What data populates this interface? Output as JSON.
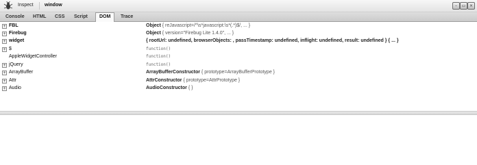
{
  "toolbar": {
    "inspect_label": "Inspect",
    "title": "window"
  },
  "tabs": [
    "Console",
    "HTML",
    "CSS",
    "Script",
    "DOM",
    "Trace"
  ],
  "active_tab": "DOM",
  "window_controls": {
    "minimize_glyph": "–",
    "restore_glyph": "▭",
    "close_glyph": "×"
  },
  "dom_rows": [
    {
      "name": "FBL",
      "value": "Object",
      "detail": "{ reJavascript=/^\\s*javascript:\\s*(.*)$/, ... }"
    },
    {
      "name": "Firebug",
      "value": "Object",
      "detail": "{ version=\"Firebug Lite 1.4.0\", ... }"
    },
    {
      "name": "widget",
      "value": "{ rootUrl: undefined, browserObjects: , passTimestamp: undefined, inflight: undefined, result: undefined } { ... }",
      "detail": ""
    },
    {
      "name": "$",
      "value": "function()",
      "detail": ""
    },
    {
      "name": "AppleWidgetController",
      "value": "function()",
      "detail": ""
    },
    {
      "name": "jQuery",
      "value": "function()",
      "detail": ""
    },
    {
      "name": "ArrayBuffer",
      "value": "ArrayBufferConstructor",
      "detail": "{ prototype=ArrayBufferPrototype }"
    },
    {
      "name": "Attr",
      "value": "AttrConstructor",
      "detail": "{ prototype=AttrPrototype }"
    },
    {
      "name": "Audio",
      "value": "AudioConstructor",
      "detail": "{ }"
    }
  ],
  "expander_glyph": "+",
  "colors": {
    "toolbar_bg": "#e9e9e9",
    "tabbar_bg": "#d4d4d4",
    "panel_bg": "#ffffff"
  }
}
